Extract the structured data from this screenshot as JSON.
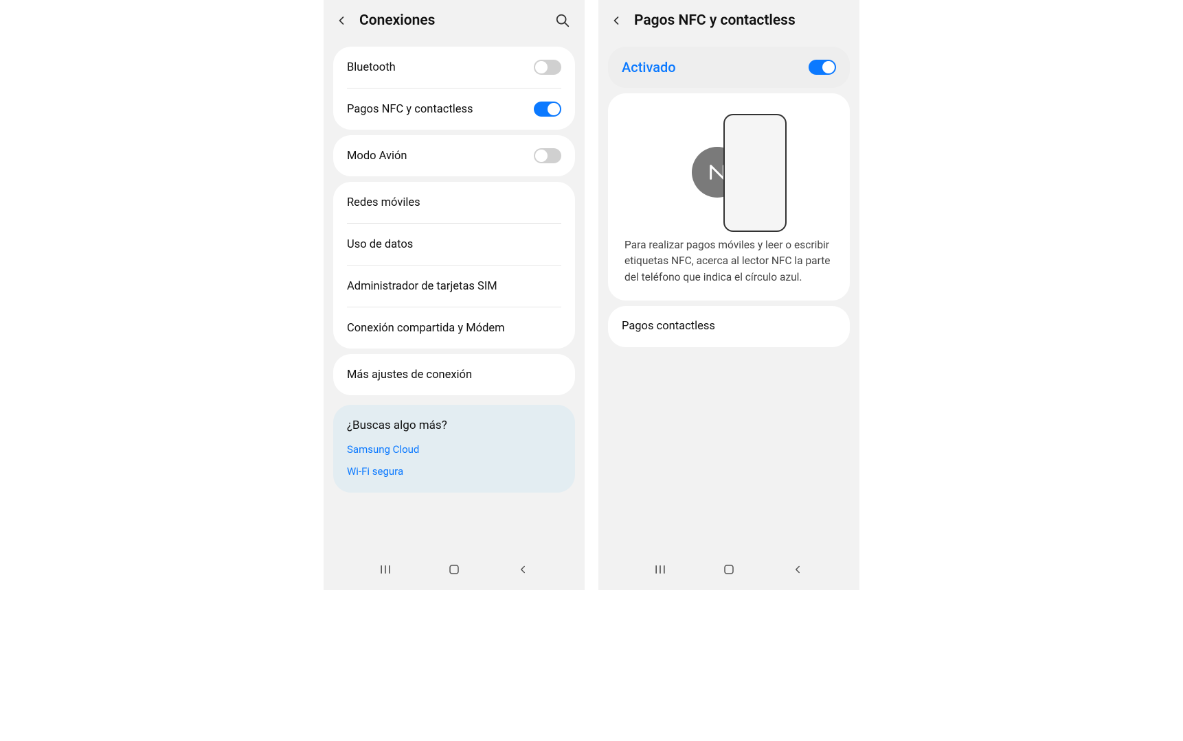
{
  "left": {
    "title": "Conexiones",
    "group1": {
      "bluetooth": {
        "label": "Bluetooth",
        "on": false
      },
      "nfc": {
        "label": "Pagos NFC y contactless",
        "on": true
      }
    },
    "group2": {
      "airplane": {
        "label": "Modo Avión",
        "on": false
      }
    },
    "group3": {
      "mobile_networks": "Redes móviles",
      "data_usage": "Uso de datos",
      "sim_manager": "Administrador de tarjetas SIM",
      "tethering": "Conexión compartida y Módem"
    },
    "group4": {
      "more": "Más ajustes de conexión"
    },
    "suggest": {
      "title": "¿Buscas algo más?",
      "links": [
        "Samsung Cloud",
        "Wi-Fi segura"
      ]
    }
  },
  "right": {
    "title": "Pagos NFC y contactless",
    "activated": {
      "label": "Activado",
      "on": true
    },
    "description": "Para realizar pagos móviles y leer o escribir etiquetas NFC, acerca al lector NFC la parte del teléfono que indica el círculo azul.",
    "contactless": "Pagos contactless"
  }
}
